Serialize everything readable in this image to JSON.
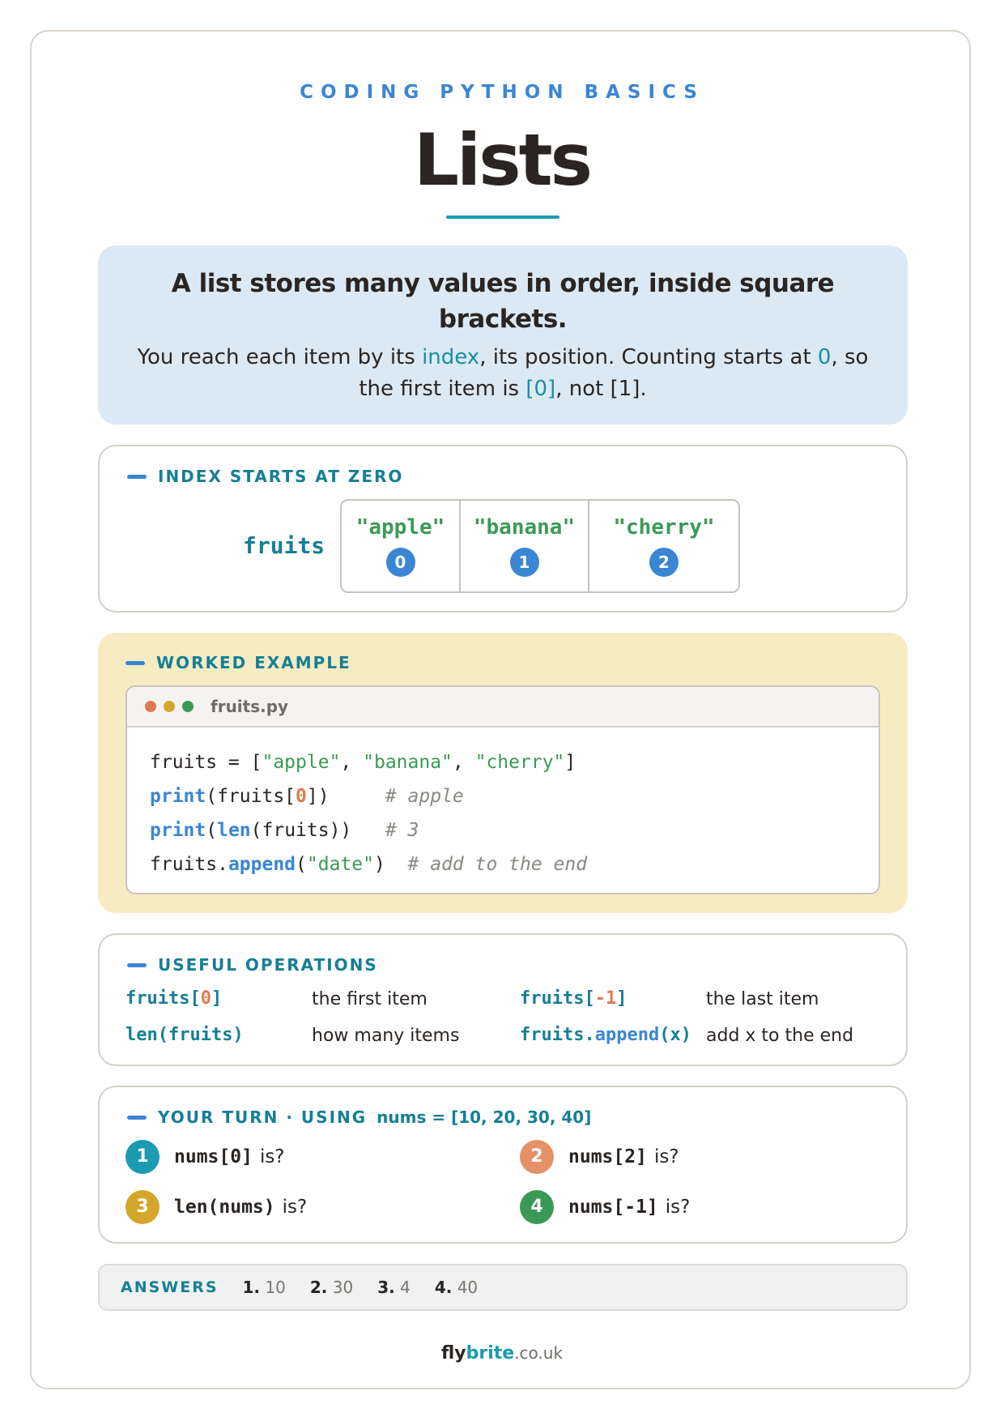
{
  "kicker": "CODING PYTHON BASICS",
  "title": "Lists",
  "intro": {
    "lead": "A list stores many values in order, inside square brackets.",
    "body_1": "You reach each item by its ",
    "body_index": "index",
    "body_2": ", its position. Counting starts at ",
    "body_zero": "0",
    "body_3": ", so the first item is ",
    "body_first": "[0]",
    "body_4": ", not [1]."
  },
  "index_section": {
    "heading": "INDEX STARTS AT ZERO",
    "variable": "fruits",
    "cells": [
      {
        "value": "\"apple\"",
        "index": "0"
      },
      {
        "value": "\"banana\"",
        "index": "1"
      },
      {
        "value": "\"cherry\"",
        "index": "2"
      }
    ]
  },
  "worked_example": {
    "heading": "WORKED EXAMPLE",
    "filename": "fruits.py",
    "dot_colors": [
      "#e07a4d",
      "#d4a72c",
      "#3a9a55"
    ],
    "line1": {
      "a": "fruits = [",
      "s1": "\"apple\"",
      "c1": ", ",
      "s2": "\"banana\"",
      "c2": ", ",
      "s3": "\"cherry\"",
      "end": "]"
    },
    "line2": {
      "fn": "print",
      "a": "(fruits[",
      "num": "0",
      "b": "])",
      "pad": "     ",
      "cmt": "# apple"
    },
    "line3": {
      "fn": "print",
      "a": "(",
      "fn2": "len",
      "b": "(fruits))",
      "pad": "   ",
      "cmt": "# 3"
    },
    "line4": {
      "a": "fruits.",
      "fn": "append",
      "b": "(",
      "s": "\"date\"",
      "c": ")",
      "pad": "  ",
      "cmt": "# add to the end"
    }
  },
  "operations": {
    "heading": "USEFUL OPERATIONS",
    "items": [
      {
        "code_a": "fruits[",
        "code_num": "0",
        "code_b": "]",
        "desc": "the first item"
      },
      {
        "code_a": "fruits[",
        "code_num": "-1",
        "code_b": "]",
        "desc": "the last item"
      },
      {
        "code_a": "len(fruits)",
        "desc": "how many items"
      },
      {
        "code_a": "fruits.",
        "code_fn": "append",
        "code_b": "(x)",
        "desc": "add x to the end"
      }
    ]
  },
  "your_turn": {
    "heading": "YOUR TURN · USING",
    "list_def": "nums = [10, 20, 30, 40]",
    "questions": [
      {
        "num": "1",
        "code": "nums[0]",
        "suffix": "is?",
        "color": "#1a9bb0"
      },
      {
        "num": "2",
        "code": "nums[2]",
        "suffix": "is?",
        "color": "#e59068"
      },
      {
        "num": "3",
        "code": "len(nums)",
        "suffix": "is?",
        "color": "#d4a72c"
      },
      {
        "num": "4",
        "code": "nums[-1]",
        "suffix": "is?",
        "color": "#3a9a55"
      }
    ]
  },
  "answers": {
    "label": "ANSWERS",
    "items": [
      {
        "num": "1.",
        "value": "10"
      },
      {
        "num": "2.",
        "value": "30"
      },
      {
        "num": "3.",
        "value": "4"
      },
      {
        "num": "4.",
        "value": "40"
      }
    ]
  },
  "footer": {
    "fly": "fly",
    "brite": "brite",
    "domain": ".co.uk"
  }
}
